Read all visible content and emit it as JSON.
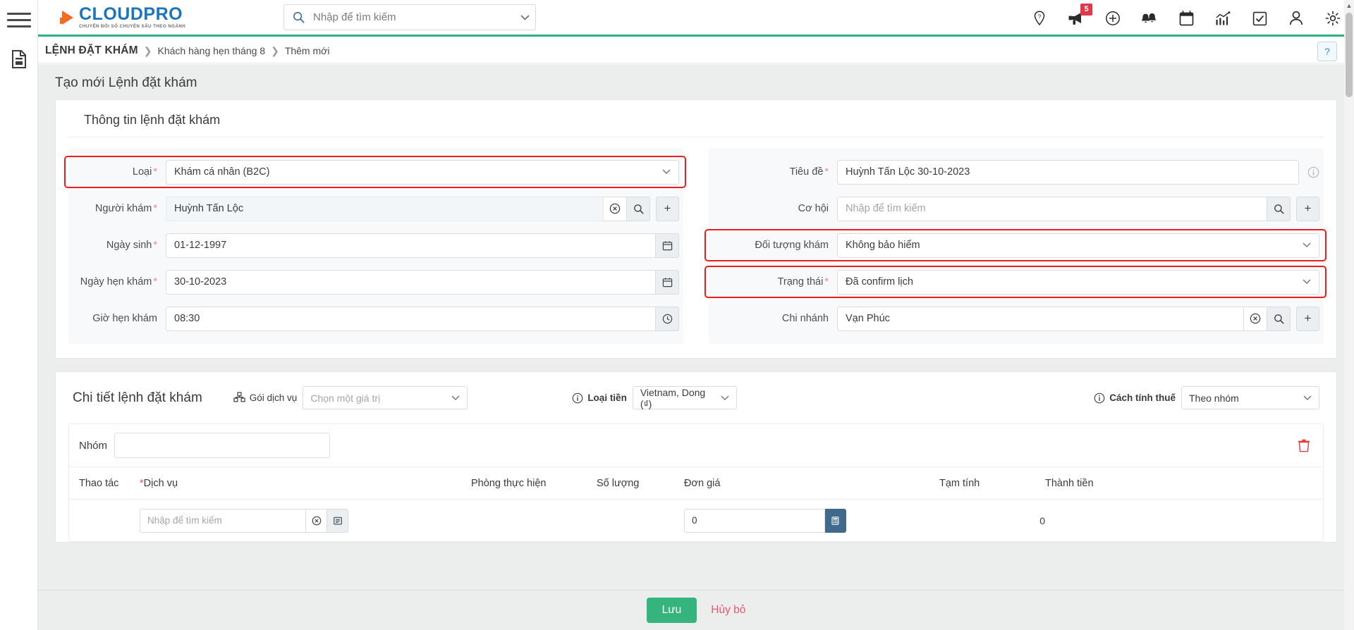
{
  "brand": {
    "name_part1": "CLOUD",
    "name_part2": "PRO",
    "tagline": "CHUYỂN ĐỔI SỐ CHUYÊN SÂU THEO NGÀNH",
    "accent_blue": "#1b75bc",
    "accent_orange": "#f26b21",
    "accent_green": "#2fb17f"
  },
  "search": {
    "placeholder": "Nhập để tìm kiếm",
    "value": ""
  },
  "header_icons": [
    {
      "name": "location-help-icon",
      "badge": ""
    },
    {
      "name": "megaphone-icon",
      "badge": "5"
    },
    {
      "name": "plus-circle-icon",
      "badge": ""
    },
    {
      "name": "bells-icon",
      "badge": ""
    },
    {
      "name": "calendar-icon",
      "badge": ""
    },
    {
      "name": "chart-icon",
      "badge": ""
    },
    {
      "name": "checkbox-icon",
      "badge": ""
    },
    {
      "name": "user-icon",
      "badge": ""
    },
    {
      "name": "gear-icon",
      "badge": ""
    }
  ],
  "breadcrumb": {
    "root": "LỆNH ĐẶT KHÁM",
    "separator": "❯",
    "items": [
      "Khách hàng hẹn tháng 8",
      "Thêm mới"
    ],
    "help_label": "?"
  },
  "page": {
    "title": "Tạo mới Lệnh đặt khám"
  },
  "info_card": {
    "title": "Thông tin lệnh đặt khám",
    "left_fields": [
      {
        "label": "Loại",
        "required": true,
        "type": "select",
        "value": "Khám cá nhân (B2C)",
        "highlight": true
      },
      {
        "label": "Người khám",
        "required": true,
        "type": "lookup",
        "value": "Huỳnh Tấn Lộc",
        "highlight": false
      },
      {
        "label": "Ngày sinh",
        "required": true,
        "type": "date",
        "value": "01-12-1997",
        "highlight": false
      },
      {
        "label": "Ngày hẹn khám",
        "required": true,
        "type": "date",
        "value": "30-10-2023",
        "highlight": false
      },
      {
        "label": "Giờ hẹn khám",
        "required": false,
        "type": "time",
        "value": "08:30",
        "highlight": false
      }
    ],
    "right_fields": [
      {
        "label": "Tiêu đề",
        "required": true,
        "type": "text-info",
        "value": "Huỳnh Tấn Lộc 30-10-2023",
        "highlight": false
      },
      {
        "label": "Cơ hội",
        "required": false,
        "type": "search-add",
        "value": "",
        "placeholder": "Nhập để tìm kiếm",
        "highlight": false
      },
      {
        "label": "Đối tượng khám",
        "required": false,
        "type": "select",
        "value": "Không bảo hiểm",
        "highlight": true
      },
      {
        "label": "Trạng thái",
        "required": true,
        "type": "select",
        "value": "Đã confirm lịch",
        "highlight": true
      },
      {
        "label": "Chi nhánh",
        "required": false,
        "type": "lookup",
        "value": "Vạn Phúc",
        "highlight": false
      }
    ]
  },
  "detail_card": {
    "title": "Chi tiết lệnh đặt khám",
    "service_package": {
      "icon": "package-icon",
      "label": "Gói dịch vụ",
      "value": "Chọn một giá trị",
      "is_placeholder": true
    },
    "currency": {
      "icon": "info-icon",
      "label": "Loại tiền",
      "value": "Vietnam, Dong (₫)",
      "is_placeholder": false
    },
    "tax_method": {
      "icon": "info-icon",
      "label": "Cách tính thuế",
      "value": "Theo nhóm",
      "is_placeholder": false
    },
    "group": {
      "label": "Nhóm",
      "value": "",
      "delete_icon": "trash-icon"
    },
    "table_headers": [
      "Thao tác",
      "Dịch vụ",
      "Phòng thực hiện",
      "Số lượng",
      "Đơn giá",
      "Tạm tính",
      "Thành tiền"
    ],
    "service_required_star": "*",
    "row": {
      "service_placeholder": "Nhập để tìm kiếm",
      "unit_price": "0",
      "subtotal": "0"
    }
  },
  "footer": {
    "save_label": "Lưu",
    "cancel_label": "Hủy bỏ"
  }
}
